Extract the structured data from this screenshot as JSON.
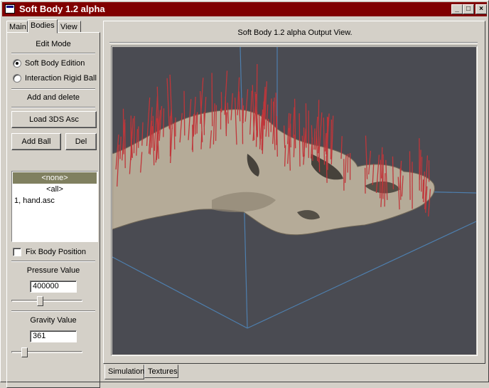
{
  "window": {
    "title": "Soft Body 1.2 alpha",
    "minimize_glyph": "_",
    "maximize_glyph": "□",
    "close_glyph": "×"
  },
  "left_tabs": [
    {
      "label": "Main",
      "active": false
    },
    {
      "label": "Bodies",
      "active": true
    },
    {
      "label": "View",
      "active": false
    }
  ],
  "edit_mode": {
    "heading": "Edit Mode",
    "options": [
      {
        "label": "Soft Body Edition",
        "checked": true
      },
      {
        "label": "Interaction Rigid Ball",
        "checked": false
      }
    ]
  },
  "add_delete": {
    "heading": "Add and delete",
    "load_button": "Load 3DS Asc",
    "add_ball_button": "Add Ball",
    "del_button": "Del"
  },
  "bodies_list": {
    "items": [
      {
        "label": "<none>",
        "selected": true
      },
      {
        "label": "<all>",
        "selected": false
      },
      {
        "label": "1, hand.asc",
        "selected": false
      }
    ]
  },
  "fix_body": {
    "label": "Fix Body Position",
    "checked": false
  },
  "pressure": {
    "heading": "Pressure Value",
    "value": "400000",
    "slider_fraction": 0.4
  },
  "gravity": {
    "heading": "Gravity Value",
    "value": "361",
    "slider_fraction": 0.15
  },
  "output_view": {
    "title": "Soft Body 1.2 alpha Output View."
  },
  "bottom_tabs": [
    {
      "label": "Simulation",
      "active": true
    },
    {
      "label": "Textures",
      "active": false
    }
  ],
  "colors": {
    "titlebar": "#800000",
    "viewport_bg": "#4a4b52",
    "grid_lines": "#4e7fae",
    "force_lines": "#c0363a",
    "body_fill": "#b5ab98"
  }
}
